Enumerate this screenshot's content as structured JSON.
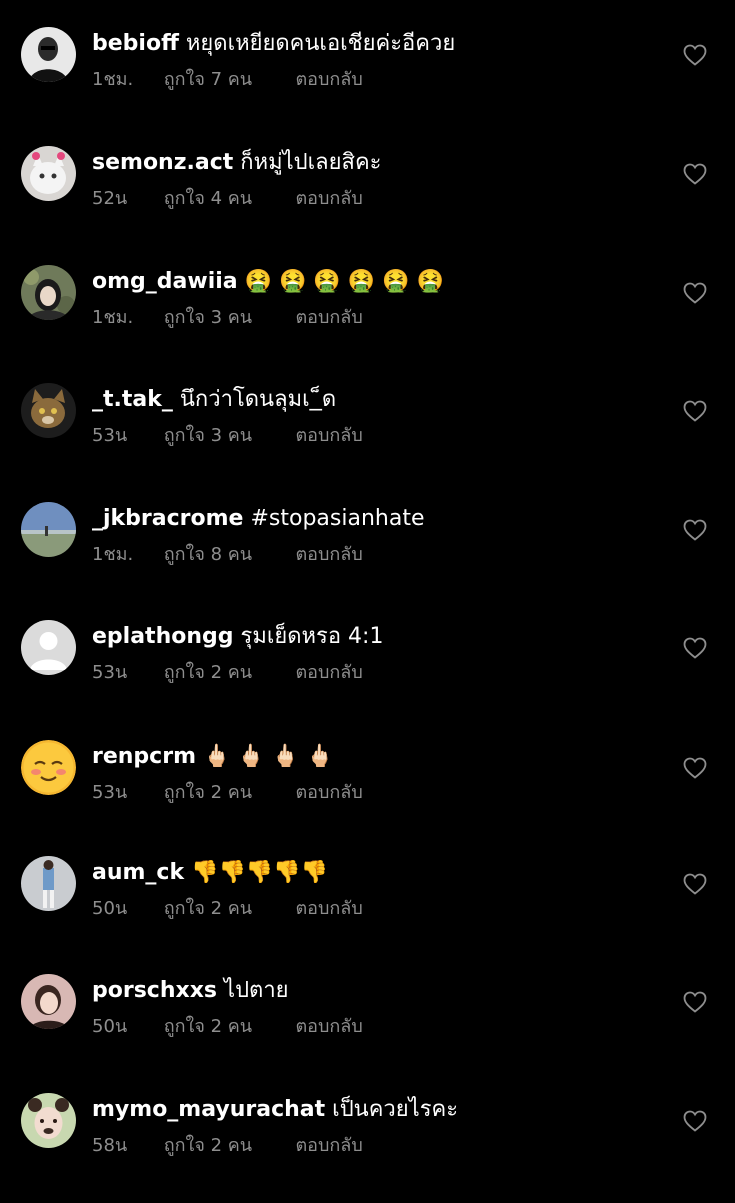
{
  "comments": [
    {
      "username": "bebioff",
      "text": "หยุดเหยียดคนเอเชียค่ะอีควย",
      "time": "1ชม.",
      "likes": "ถูกใจ 7 คน",
      "reply": "ตอบกลับ"
    },
    {
      "username": "semonz.act",
      "text": "ก็หมู่ไปเลยสิคะ",
      "time": "52น",
      "likes": "ถูกใจ 4 คน",
      "reply": "ตอบกลับ"
    },
    {
      "username": "omg_dawiia",
      "text": "🤮 🤮 🤮 🤮 🤮 🤮",
      "time": "1ชม.",
      "likes": "ถูกใจ 3 คน",
      "reply": "ตอบกลับ"
    },
    {
      "username": "_t.tak_",
      "text": "นึกว่าโดนลุมเ_็ด",
      "time": "53น",
      "likes": "ถูกใจ 3 คน",
      "reply": "ตอบกลับ"
    },
    {
      "username": "_jkbracrome",
      "text": "#stopasianhate",
      "time": "1ชม.",
      "likes": "ถูกใจ 8 คน",
      "reply": "ตอบกลับ"
    },
    {
      "username": "eplathongg",
      "text": "รุมเย็ดหรอ 4:1",
      "time": "53น",
      "likes": "ถูกใจ 2 คน",
      "reply": "ตอบกลับ"
    },
    {
      "username": "renpcrm",
      "text": "🖕🏻 🖕🏻 🖕🏻 🖕🏻",
      "time": "53น",
      "likes": "ถูกใจ 2 คน",
      "reply": "ตอบกลับ"
    },
    {
      "username": "aum_ck",
      "text": "👎👎👎👎👎",
      "time": "50น",
      "likes": "ถูกใจ 2 คน",
      "reply": "ตอบกลับ"
    },
    {
      "username": "porschxxs",
      "text": "ไปตาย",
      "time": "50น",
      "likes": "ถูกใจ 2 คน",
      "reply": "ตอบกลับ"
    },
    {
      "username": "mymo_mayurachat",
      "text": "เป็นควยไรคะ",
      "time": "58น",
      "likes": "ถูกใจ 2 คน",
      "reply": "ตอบกลับ"
    }
  ],
  "colors": {
    "background": "#000000",
    "primary_text": "#ffffff",
    "secondary_text": "#8e8e8e"
  },
  "icons": {
    "like": "heart-outline-icon"
  }
}
